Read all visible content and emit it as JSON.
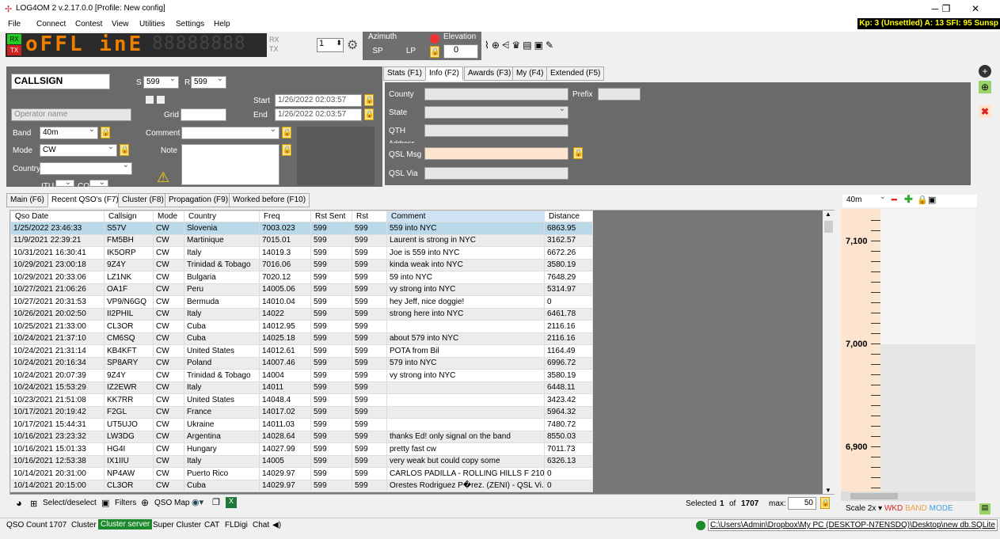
{
  "app": {
    "title": "LOG4OM 2 v.2.17.0.0 [Profile: New config]"
  },
  "menu": [
    "File",
    "Connect",
    "Contest",
    "View",
    "Utilities",
    "Settings",
    "Help"
  ],
  "kp_status": "Kp: 3 (Unsettled)  A: 13  SFI: 95 Sunsp",
  "radio": {
    "rx": "RX",
    "tx": "TX",
    "display": "oFFL inE",
    "ghost": "88888888",
    "rx2": "RX",
    "tx2": "TX",
    "antenna_value": "1",
    "azimuth_label": "Azimuth",
    "sp": "SP",
    "lp": "LP",
    "elevation_label": "Elevation",
    "elevation_value": "0"
  },
  "qso_entry": {
    "callsign_placeholder": "CALLSIGN",
    "s_label": "S",
    "s_value": "599",
    "r_label": "R",
    "r_value": "599",
    "start_label": "Start",
    "start_value": "1/26/2022 02:03:57",
    "end_label": "End",
    "end_value": "1/26/2022 02:03:57",
    "operator_placeholder": "Operator name",
    "grid_label": "Grid",
    "band_label": "Band",
    "band_value": "40m",
    "comment_label": "Comment",
    "mode_label": "Mode",
    "mode_value": "CW",
    "note_label": "Note",
    "country_label": "Country",
    "itu_label": "ITU",
    "cq_label": "CQ"
  },
  "info_tabs": [
    "Stats (F1)",
    "Info (F2)",
    "Awards (F3)",
    "My (F4)",
    "Extended (F5)"
  ],
  "info": {
    "county": "County",
    "prefix": "Prefix",
    "state": "State",
    "qth": "QTH",
    "address": "Address",
    "qsl_msg": "QSL Msg",
    "qsl_via": "QSL Via"
  },
  "main_tabs": [
    "Main (F6)",
    "Recent QSO's (F7)",
    "Cluster (F8)",
    "Propagation (F9)",
    "Worked before (F10)"
  ],
  "table": {
    "columns": [
      "Qso Date",
      "Callsign",
      "Mode",
      "Country",
      "Freq",
      "Rst Sent",
      "Rst",
      "Comment",
      "Distance"
    ],
    "rows": [
      [
        "1/25/2022 23:46:33",
        "S57V",
        "CW",
        "Slovenia",
        "7003.023",
        "599",
        "599",
        "559 into NYC",
        "6863.95"
      ],
      [
        "11/9/2021 22:39:21",
        "FM5BH",
        "CW",
        "Martinique",
        "7015.01",
        "599",
        "599",
        "Laurent is strong in NYC",
        "3162.57"
      ],
      [
        "10/31/2021 16:30:41",
        "IK5ORP",
        "CW",
        "Italy",
        "14019.3",
        "599",
        "599",
        "Joe is 559 into NYC",
        "6672.26"
      ],
      [
        "10/29/2021 23:00:18",
        "9Z4Y",
        "CW",
        "Trinidad & Tobago",
        "7016.06",
        "599",
        "599",
        "kinda weak into NYC",
        "3580.19"
      ],
      [
        "10/29/2021 20:33:06",
        "LZ1NK",
        "CW",
        "Bulgaria",
        "7020.12",
        "599",
        "599",
        "59 into NYC",
        "7648.29"
      ],
      [
        "10/27/2021 21:06:26",
        "OA1F",
        "CW",
        "Peru",
        "14005.06",
        "599",
        "599",
        "vy strong into NYC",
        "5314.97"
      ],
      [
        "10/27/2021 20:31:53",
        "VP9/N6GQ",
        "CW",
        "Bermuda",
        "14010.04",
        "599",
        "599",
        "hey Jeff, nice doggie!",
        "0"
      ],
      [
        "10/26/2021 20:02:50",
        "II2PHIL",
        "CW",
        "Italy",
        "14022",
        "599",
        "599",
        "strong here into NYC",
        "6461.78"
      ],
      [
        "10/25/2021 21:33:00",
        "CL3OR",
        "CW",
        "Cuba",
        "14012.95",
        "599",
        "599",
        "",
        "2116.16"
      ],
      [
        "10/24/2021 21:37:10",
        "CM6SQ",
        "CW",
        "Cuba",
        "14025.18",
        "599",
        "599",
        "about 579 into NYC",
        "2116.16"
      ],
      [
        "10/24/2021 21:31:14",
        "KB4KFT",
        "CW",
        "United States",
        "14012.61",
        "599",
        "599",
        "POTA from Bil",
        "1164.49"
      ],
      [
        "10/24/2021 20:16:34",
        "SP8ARY",
        "CW",
        "Poland",
        "14007.46",
        "599",
        "599",
        "579 into NYC",
        "6996.72"
      ],
      [
        "10/24/2021 20:07:39",
        "9Z4Y",
        "CW",
        "Trinidad & Tobago",
        "14004",
        "599",
        "599",
        "vy strong into NYC",
        "3580.19"
      ],
      [
        "10/24/2021 15:53:29",
        "IZ2EWR",
        "CW",
        "Italy",
        "14011",
        "599",
        "599",
        "",
        "6448.11"
      ],
      [
        "10/23/2021 21:51:08",
        "KK7RR",
        "CW",
        "United States",
        "14048.4",
        "599",
        "599",
        "",
        "3423.42"
      ],
      [
        "10/17/2021 20:19:42",
        "F2GL",
        "CW",
        "France",
        "14017.02",
        "599",
        "599",
        "",
        "5964.32"
      ],
      [
        "10/17/2021 15:44:31",
        "UT5UJO",
        "CW",
        "Ukraine",
        "14011.03",
        "599",
        "599",
        "",
        "7480.72"
      ],
      [
        "10/16/2021 23:23:32",
        "LW3DG",
        "CW",
        "Argentina",
        "14028.64",
        "599",
        "599",
        "thanks Ed! only signal on the band",
        "8550.03"
      ],
      [
        "10/16/2021 15:01:33",
        "HG4I",
        "CW",
        "Hungary",
        "14027.99",
        "599",
        "599",
        "pretty fast cw",
        "7011.73"
      ],
      [
        "10/16/2021 12:53:38",
        "IX1IIU",
        "CW",
        "Italy",
        "14005",
        "599",
        "599",
        "very weak but could copy some",
        "6326.13"
      ],
      [
        "10/14/2021 20:31:00",
        "NP4AW",
        "CW",
        "Puerto Rico",
        "14029.97",
        "599",
        "599",
        "CARLOS PADILLA - ROLLING HILLS F 210 ...",
        "0"
      ],
      [
        "10/14/2021 20:15:00",
        "CL3OR",
        "CW",
        "Cuba",
        "14029.97",
        "599",
        "599",
        "Orestes Rodriguez P�rez. (ZENI) - QSL Vi...",
        "0"
      ]
    ]
  },
  "bandmap": {
    "band": "40m",
    "freqs": [
      "7,100",
      "7,000",
      "6,900"
    ],
    "scale": "Scale 2x",
    "wkd": "WKD",
    "band_lbl": "BAND",
    "mode_lbl": "MODE",
    "colors": {
      "wkd": "#e02020",
      "band": "#f0a040",
      "mode": "#40a0e0"
    }
  },
  "bottom": {
    "select": "Select/deselect",
    "filters": "Filters",
    "qso_map": "QSO Map",
    "selected_label": "Selected",
    "selected": "1",
    "of": "of",
    "total": "1707",
    "max_label": "max:",
    "max": "50"
  },
  "status": {
    "qso_count_label": "QSO Count",
    "qso_count": "1707",
    "cluster": "Cluster",
    "cluster_server": "Cluster server",
    "super_cluster": "Super Cluster",
    "cat": "CAT",
    "fldigi": "FLDigi",
    "chat": "Chat",
    "db_path": "C:\\Users\\Admin\\Dropbox\\My PC (DESKTOP-N7ENSDQ)\\Desktop\\new db.SQLite"
  }
}
